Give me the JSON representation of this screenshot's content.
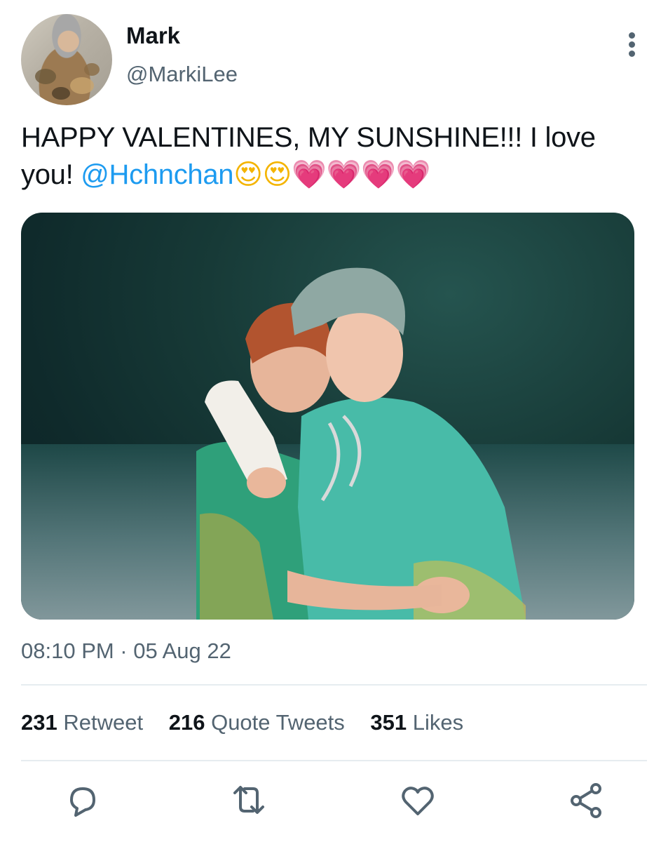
{
  "user": {
    "name": "Mark",
    "handle": "@MarkiLee"
  },
  "tweet": {
    "text_before": "HAPPY VALENTINES, MY SUNSHINE!!! I love you! ",
    "mention": "@Hchnchan",
    "emojis": [
      "😍",
      "😍",
      "💗",
      "💗",
      "💗",
      "💗"
    ]
  },
  "media": {
    "description_icon": "photo"
  },
  "meta": {
    "timestamp": "08:10 PM · 05 Aug 22"
  },
  "stats": {
    "retweets_count": "231",
    "retweets_label": "Retweet",
    "quotes_count": "216",
    "quotes_label": "Quote Tweets",
    "likes_count": "351",
    "likes_label": "Likes"
  },
  "actions": {
    "reply_icon": "reply-icon",
    "retweet_icon": "retweet-icon",
    "like_icon": "like-icon",
    "share_icon": "share-icon"
  },
  "colors": {
    "mention": "#1d9bf0",
    "secondary_text": "#536471",
    "primary_text": "#0f1419"
  }
}
